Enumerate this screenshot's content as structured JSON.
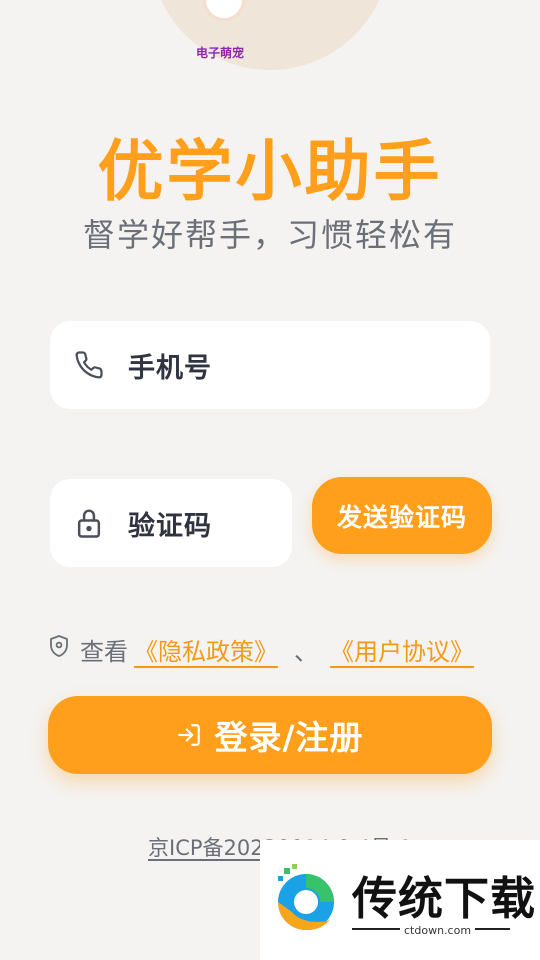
{
  "header": {
    "caption": "电子萌宠"
  },
  "app": {
    "title": "优学小助手",
    "subtitle": "督学好帮手，习惯轻松有"
  },
  "form": {
    "phone_label": "手机号",
    "code_label": "验证码",
    "send_code_label": "发送验证码"
  },
  "agreement": {
    "prefix": "查看",
    "privacy_link": "《隐私政策》",
    "separator": "、",
    "user_link": "《用户协议》"
  },
  "login": {
    "label": "登录/注册"
  },
  "footer": {
    "icp": "京ICP备20230014 0 4号-1"
  },
  "watermark": {
    "brand": "传统下载",
    "site": "ctdown.com"
  },
  "colors": {
    "accent": "#ff9f1c",
    "background": "#f4f3f1",
    "text": "#6b6f78"
  },
  "icons": {
    "phone": "phone-icon",
    "lock": "lock-icon",
    "shield": "shield-icon",
    "login": "login-arrow-icon"
  }
}
